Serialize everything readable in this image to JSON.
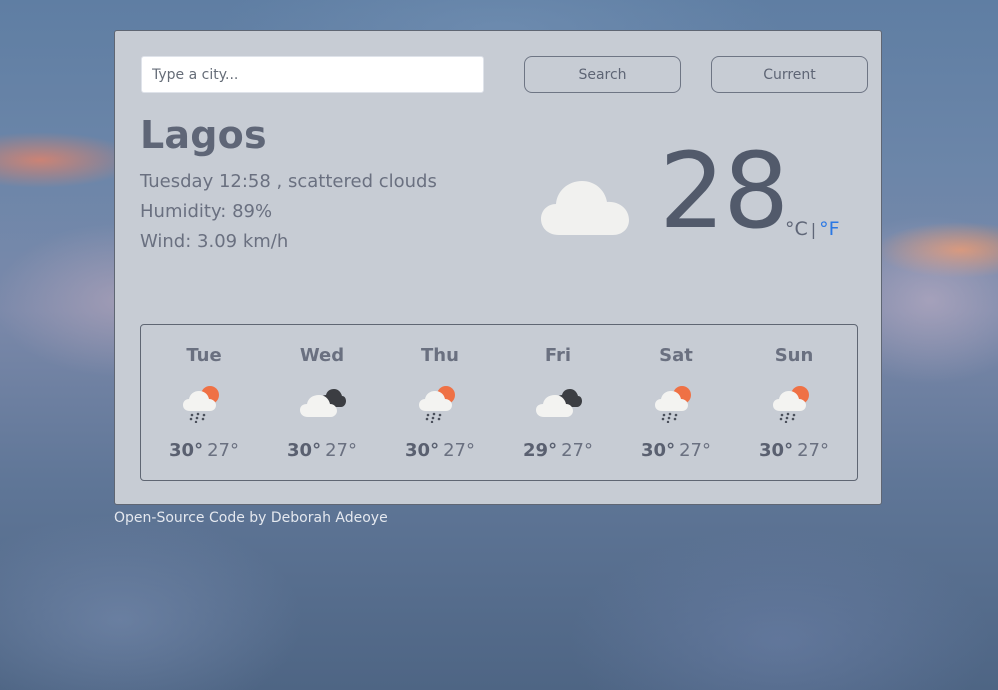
{
  "search": {
    "placeholder": "Type a city...",
    "value": ""
  },
  "buttons": {
    "search_label": "Search",
    "current_label": "Current"
  },
  "current": {
    "city": "Lagos",
    "datetime_description": "Tuesday 12:58 , scattered clouds",
    "humidity": "Humidity: 89%",
    "wind": "Wind: 3.09 km/h",
    "temperature": "28",
    "unit_celsius": "°C",
    "unit_separator": "|",
    "unit_fahrenheit": "°F",
    "icon": "cloud-icon"
  },
  "forecast": [
    {
      "day": "Tue",
      "icon": "sun-rain-cloud-icon",
      "high": "30°",
      "low": "27°"
    },
    {
      "day": "Wed",
      "icon": "dark-cloud-icon",
      "high": "30°",
      "low": "27°"
    },
    {
      "day": "Thu",
      "icon": "sun-rain-cloud-icon",
      "high": "30°",
      "low": "27°"
    },
    {
      "day": "Fri",
      "icon": "dark-cloud-icon",
      "high": "29°",
      "low": "27°"
    },
    {
      "day": "Sat",
      "icon": "sun-rain-cloud-icon",
      "high": "30°",
      "low": "27°"
    },
    {
      "day": "Sun",
      "icon": "sun-rain-cloud-icon",
      "high": "30°",
      "low": "27°"
    }
  ],
  "footer": {
    "text": "Open-Source Code by Deborah Adeoye"
  },
  "colors": {
    "card_bg": "#c7ccd4",
    "accent_link": "#2b78e4",
    "text_primary": "#5f6677"
  }
}
